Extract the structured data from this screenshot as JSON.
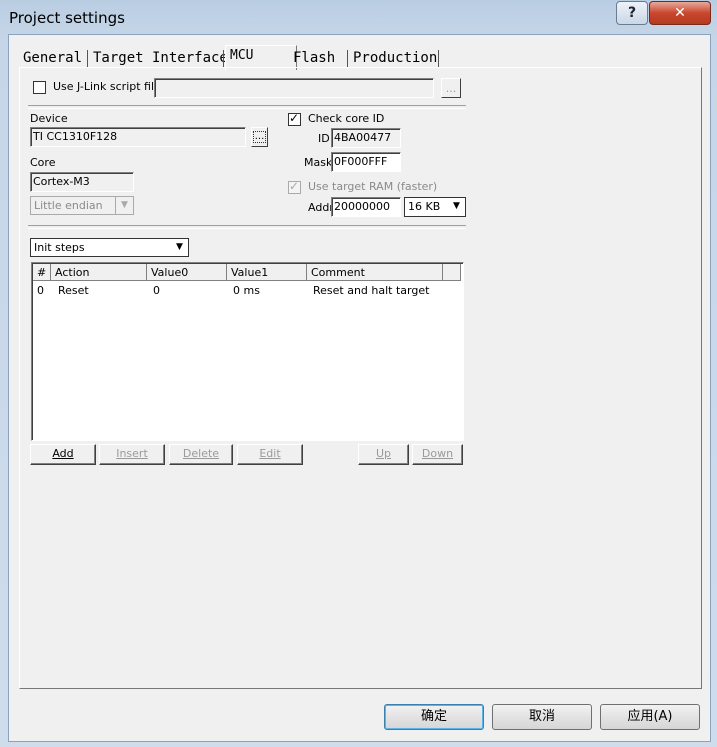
{
  "window": {
    "title": "Project settings"
  },
  "titlebar": {
    "help_glyph": "?",
    "close_glyph": "✕"
  },
  "tabs": [
    {
      "label": "General"
    },
    {
      "label": "Target Interface"
    },
    {
      "label": "MCU"
    },
    {
      "label": "Flash"
    },
    {
      "label": "Production"
    }
  ],
  "script": {
    "label": "Use J-Link script file",
    "value": "",
    "browse": "..."
  },
  "device": {
    "label": "Device",
    "value": "TI CC1310F128",
    "browse": "..."
  },
  "core": {
    "label": "Core",
    "value": "Cortex-M3",
    "endian": "Little endian"
  },
  "core_id": {
    "label": "Check core ID",
    "checked": true,
    "id_label": "ID",
    "id_value": "4BA00477",
    "mask_label": "Mask",
    "mask_value": "0F000FFF"
  },
  "target_ram": {
    "label": "Use target RAM (faster)",
    "checked": true,
    "addr_label": "Addr",
    "addr_value": "20000000",
    "size": "16 KB"
  },
  "steps": {
    "selected": "Init steps"
  },
  "table": {
    "headers": [
      "#",
      "Action",
      "Value0",
      "Value1",
      "Comment"
    ],
    "rows": [
      {
        "num": "0",
        "action": "Reset",
        "value0": "0",
        "value1": "0 ms",
        "comment": "Reset and halt target"
      }
    ]
  },
  "buttons": {
    "add": "Add",
    "insert": "Insert",
    "delete": "Delete",
    "edit": "Edit",
    "up": "Up",
    "down": "Down"
  },
  "footer": {
    "ok": "确定",
    "cancel": "取消",
    "apply": "应用(A)"
  }
}
